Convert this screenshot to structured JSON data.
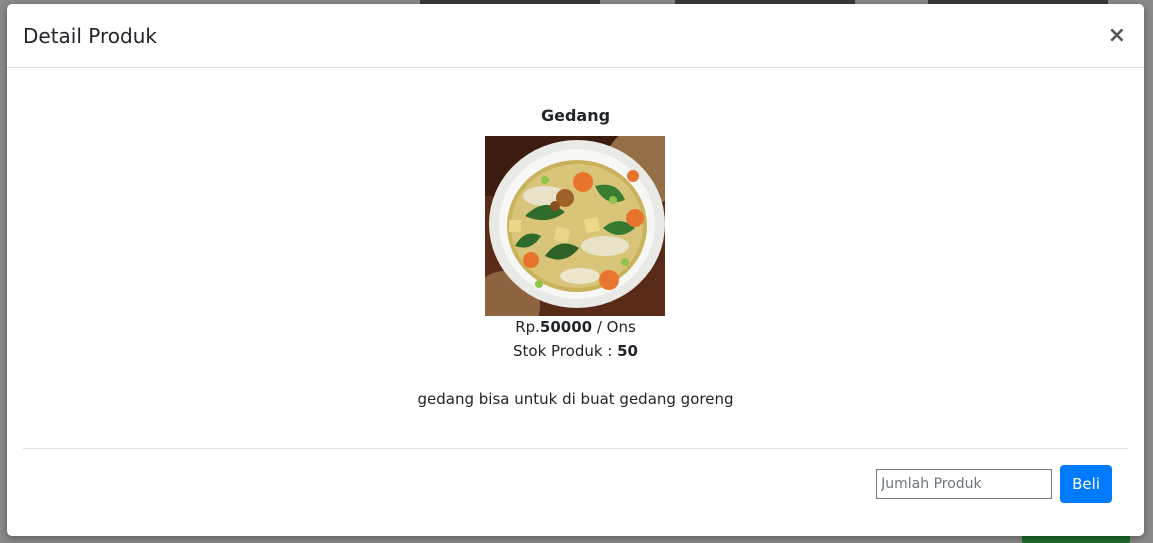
{
  "modal": {
    "title": "Detail Produk",
    "close_label": "×"
  },
  "product": {
    "name": "Gedang",
    "image_icon": "soup-bowl-image",
    "price_prefix": "Rp.",
    "price_value": "50000",
    "price_unit": " / Ons",
    "stock_label": "Stok Produk : ",
    "stock_value": "50",
    "description": "gedang bisa untuk di buat gedang goreng"
  },
  "order": {
    "quantity_placeholder": "Jumlah Produk",
    "buy_label": "Beli"
  },
  "colors": {
    "primary": "#007bff",
    "overlay": "#8a8a8a"
  }
}
